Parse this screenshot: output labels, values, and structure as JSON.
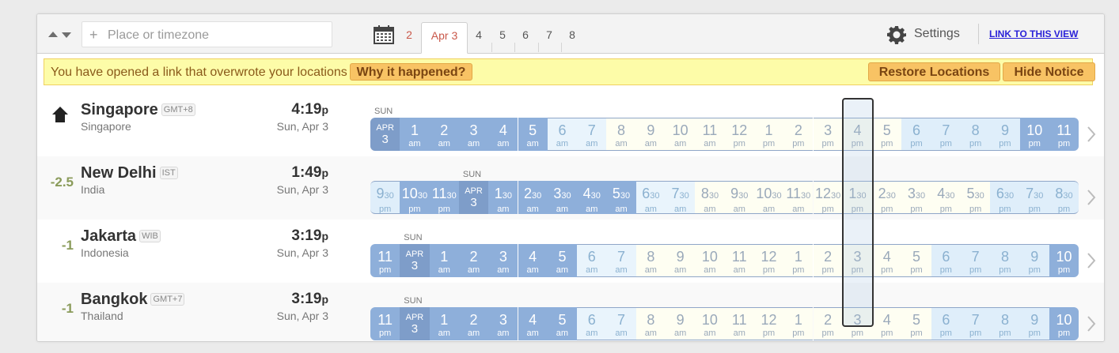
{
  "toolbar": {
    "search_placeholder": "Place or timezone",
    "date_tabs": [
      "2",
      "Apr 3",
      "4",
      "5",
      "6",
      "7",
      "8"
    ],
    "settings_label": "Settings",
    "link_label": "LINK TO THIS VIEW"
  },
  "notice": {
    "text": "You have opened a link that overwrote your locations",
    "why_label": "Why it happened?",
    "restore_label": "Restore Locations",
    "hide_label": "Hide Notice"
  },
  "colors": {
    "night": "#8eafda",
    "date_cell": "#7e9dc9",
    "notice_bg": "#fdfca8",
    "highlight_border": "#333333",
    "link": "#2a22d8"
  },
  "rows": [
    {
      "city": "Singapore",
      "badge": "GMT+8",
      "country": "Singapore",
      "offset": "",
      "time": "4:19",
      "ampm": "p",
      "date": "Sun, Apr 3",
      "sun_label": "SUN",
      "home": true,
      "strip": [
        [
          "APR",
          "3"
        ],
        [
          "1",
          "am"
        ],
        [
          "2",
          "am"
        ],
        [
          "3",
          "am"
        ],
        [
          "4",
          "am"
        ],
        [
          "5",
          "am"
        ],
        [
          "6",
          "am"
        ],
        [
          "7",
          "am"
        ],
        [
          "8",
          "am"
        ],
        [
          "9",
          "am"
        ],
        [
          "10",
          "am"
        ],
        [
          "11",
          "am"
        ],
        [
          "12",
          "pm"
        ],
        [
          "1",
          "pm"
        ],
        [
          "2",
          "pm"
        ],
        [
          "3",
          "pm"
        ],
        [
          "4",
          "pm"
        ],
        [
          "5",
          "pm"
        ],
        [
          "6",
          "pm"
        ],
        [
          "7",
          "pm"
        ],
        [
          "8",
          "pm"
        ],
        [
          "9",
          "pm"
        ],
        [
          "10",
          "pm"
        ],
        [
          "11",
          "pm"
        ]
      ]
    },
    {
      "city": "New Delhi",
      "badge": "IST",
      "country": "India",
      "offset": "-2.5",
      "time": "1:49",
      "ampm": "p",
      "date": "Sun, Apr 3",
      "sun_label": "SUN",
      "home": false,
      "strip": [
        [
          "9",
          "30",
          "pm"
        ],
        [
          "10",
          "30",
          "pm"
        ],
        [
          "11",
          "30",
          "pm"
        ],
        [
          "APR",
          "3"
        ],
        [
          "1",
          "30",
          "am"
        ],
        [
          "2",
          "30",
          "am"
        ],
        [
          "3",
          "30",
          "am"
        ],
        [
          "4",
          "30",
          "am"
        ],
        [
          "5",
          "30",
          "am"
        ],
        [
          "6",
          "30",
          "am"
        ],
        [
          "7",
          "30",
          "am"
        ],
        [
          "8",
          "30",
          "am"
        ],
        [
          "9",
          "30",
          "am"
        ],
        [
          "10",
          "30",
          "am"
        ],
        [
          "11",
          "30",
          "am"
        ],
        [
          "12",
          "30",
          "pm"
        ],
        [
          "1",
          "30",
          "pm"
        ],
        [
          "2",
          "30",
          "pm"
        ],
        [
          "3",
          "30",
          "pm"
        ],
        [
          "4",
          "30",
          "pm"
        ],
        [
          "5",
          "30",
          "pm"
        ],
        [
          "6",
          "30",
          "pm"
        ],
        [
          "7",
          "30",
          "pm"
        ],
        [
          "8",
          "30",
          "pm"
        ]
      ]
    },
    {
      "city": "Jakarta",
      "badge": "WIB",
      "country": "Indonesia",
      "offset": "-1",
      "time": "3:19",
      "ampm": "p",
      "date": "Sun, Apr 3",
      "sun_label": "SUN",
      "home": false,
      "strip": [
        [
          "11",
          "pm"
        ],
        [
          "APR",
          "3"
        ],
        [
          "1",
          "am"
        ],
        [
          "2",
          "am"
        ],
        [
          "3",
          "am"
        ],
        [
          "4",
          "am"
        ],
        [
          "5",
          "am"
        ],
        [
          "6",
          "am"
        ],
        [
          "7",
          "am"
        ],
        [
          "8",
          "am"
        ],
        [
          "9",
          "am"
        ],
        [
          "10",
          "am"
        ],
        [
          "11",
          "am"
        ],
        [
          "12",
          "pm"
        ],
        [
          "1",
          "pm"
        ],
        [
          "2",
          "pm"
        ],
        [
          "3",
          "pm"
        ],
        [
          "4",
          "pm"
        ],
        [
          "5",
          "pm"
        ],
        [
          "6",
          "pm"
        ],
        [
          "7",
          "pm"
        ],
        [
          "8",
          "pm"
        ],
        [
          "9",
          "pm"
        ],
        [
          "10",
          "pm"
        ]
      ]
    },
    {
      "city": "Bangkok",
      "badge": "GMT+7",
      "country": "Thailand",
      "offset": "-1",
      "time": "3:19",
      "ampm": "p",
      "date": "Sun, Apr 3",
      "sun_label": "SUN",
      "home": false,
      "strip": [
        [
          "11",
          "pm"
        ],
        [
          "APR",
          "3"
        ],
        [
          "1",
          "am"
        ],
        [
          "2",
          "am"
        ],
        [
          "3",
          "am"
        ],
        [
          "4",
          "am"
        ],
        [
          "5",
          "am"
        ],
        [
          "6",
          "am"
        ],
        [
          "7",
          "am"
        ],
        [
          "8",
          "am"
        ],
        [
          "9",
          "am"
        ],
        [
          "10",
          "am"
        ],
        [
          "11",
          "am"
        ],
        [
          "12",
          "pm"
        ],
        [
          "1",
          "pm"
        ],
        [
          "2",
          "pm"
        ],
        [
          "3",
          "pm"
        ],
        [
          "4",
          "pm"
        ],
        [
          "5",
          "pm"
        ],
        [
          "6",
          "pm"
        ],
        [
          "7",
          "pm"
        ],
        [
          "8",
          "pm"
        ],
        [
          "9",
          "pm"
        ],
        [
          "10",
          "pm"
        ]
      ]
    }
  ]
}
